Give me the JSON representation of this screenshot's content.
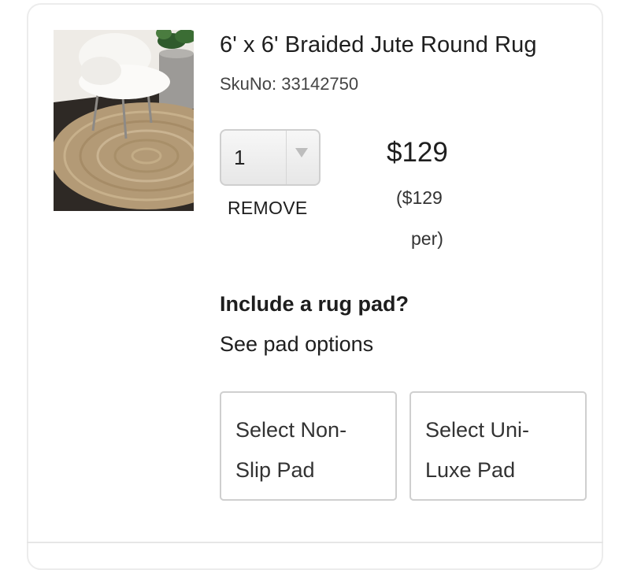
{
  "product": {
    "title": "6' x 6' Braided Jute Round Rug",
    "sku": "SkuNo: 33142750",
    "image_alt": "Braided jute round rug with white fur chair"
  },
  "quantity": {
    "value": "1"
  },
  "actions": {
    "remove_label": "REMOVE"
  },
  "pricing": {
    "price": "$129",
    "unit_price": "($129",
    "unit_label": "per)"
  },
  "rug_pad": {
    "heading": "Include a rug pad?",
    "link": "See pad options",
    "options": [
      {
        "line1": "Select Non-",
        "line2": "Slip Pad"
      },
      {
        "line1": "Select Uni-",
        "line2": "Luxe Pad"
      }
    ]
  },
  "colors": {
    "card_border": "#ececec",
    "button_border": "#cfcfcf",
    "text": "#1e1e1e"
  }
}
